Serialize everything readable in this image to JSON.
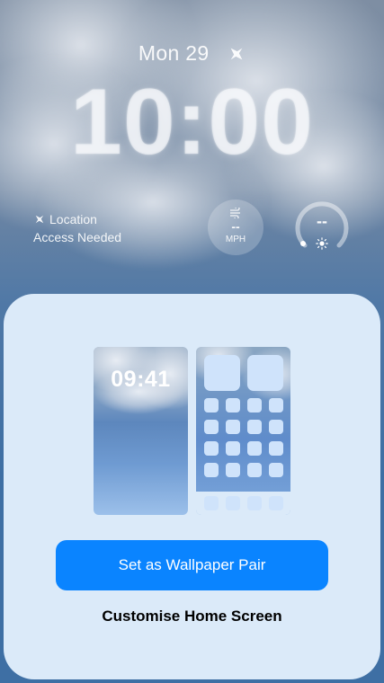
{
  "lock_screen": {
    "date": "Mon 29",
    "time": "10:00",
    "date_icon": "airplane-icon",
    "location_widget": {
      "icon": "location-off-icon",
      "line1": "Location",
      "line2": "Access Needed"
    },
    "wind_widget": {
      "icon": "wind-icon",
      "value": "--",
      "unit": "MPH"
    },
    "gauge_widget": {
      "value": "--",
      "icon": "sun-icon"
    }
  },
  "sheet": {
    "lock_preview_time": "09:41",
    "primary_button_label": "Set as Wallpaper Pair",
    "secondary_button_label": "Customise Home Screen"
  },
  "colors": {
    "accent": "#0a84ff",
    "sheet_background": "#dbeaf9",
    "tile": "#cfe3fb"
  }
}
